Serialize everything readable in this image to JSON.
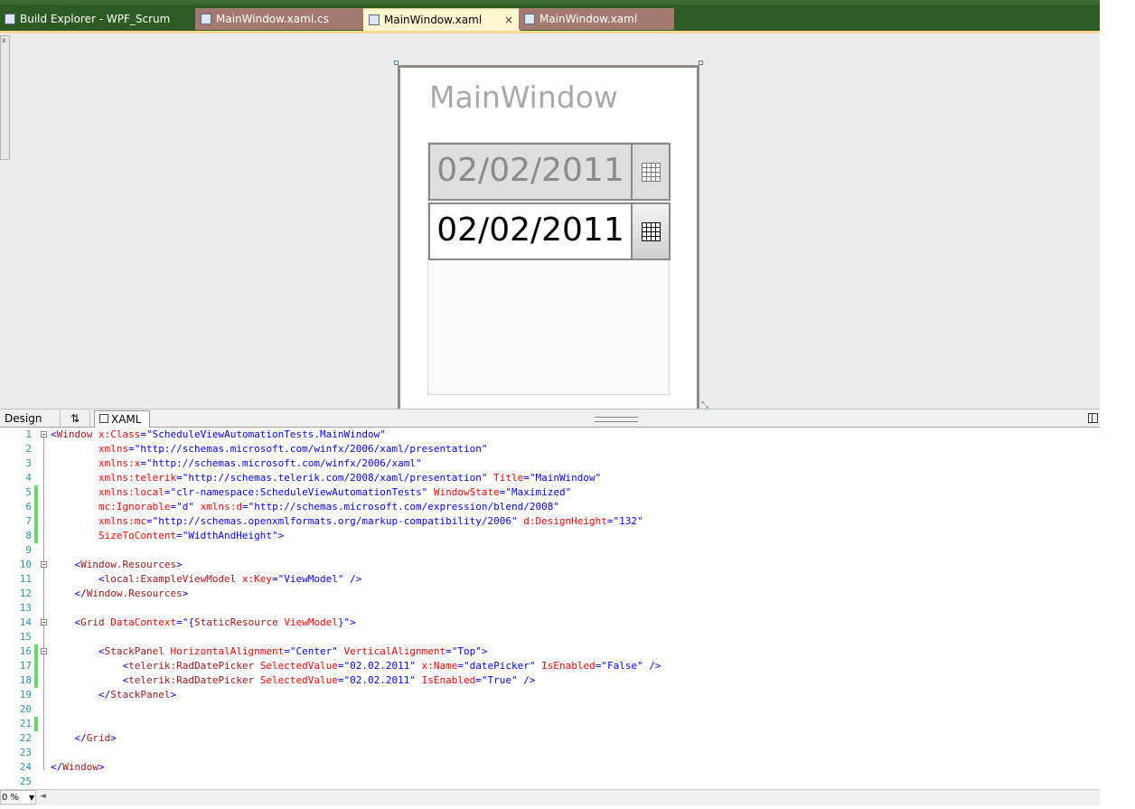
{
  "tabs": [
    {
      "label": "Build Explorer - WPF_Scrum"
    },
    {
      "label": "MainWindow.xaml.cs"
    },
    {
      "label": "MainWindow.xaml",
      "close": "×"
    },
    {
      "label": "MainWindow.xaml"
    }
  ],
  "design_preview": {
    "window_title": "MainWindow",
    "datepicker_disabled_value": "02/02/2011",
    "datepicker_enabled_value": "02/02/2011"
  },
  "pane_tabs": {
    "design": "Design",
    "swap": "⇅",
    "xaml": "XAML"
  },
  "status": {
    "zoom": "0 %"
  },
  "code_lines": [
    {
      "n": "1",
      "html": "<span class='b'>&lt;</span><span class='r'>Window</span> <span class='a'>x:Class</span><span class='b'>=\"ScheduleViewAutomationTests.MainWindow\"</span>"
    },
    {
      "n": "2",
      "html": "        <span class='a'>xmlns</span><span class='b'>=\"http://schemas.microsoft.com/winfx/2006/xaml/presentation\"</span>"
    },
    {
      "n": "3",
      "html": "        <span class='a'>xmlns:x</span><span class='b'>=\"http://schemas.microsoft.com/winfx/2006/xaml\"</span>"
    },
    {
      "n": "4",
      "html": "        <span class='a'>xmlns:telerik</span><span class='b'>=\"http://schemas.telerik.com/2008/xaml/presentation\"</span> <span class='a'>Title</span><span class='b'>=\"MainWindow\"</span>"
    },
    {
      "n": "5",
      "html": "        <span class='a'>xmlns:local</span><span class='b'>=\"clr-namespace:ScheduleViewAutomationTests\"</span> <span class='a'>WindowState</span><span class='b'>=\"Maximized\"</span>"
    },
    {
      "n": "6",
      "html": "        <span class='a'>mc:Ignorable</span><span class='b'>=\"d\"</span> <span class='a'>xmlns:d</span><span class='b'>=\"http://schemas.microsoft.com/expression/blend/2008\"</span>"
    },
    {
      "n": "7",
      "html": "        <span class='a'>xmlns:mc</span><span class='b'>=\"http://schemas.openxmlformats.org/markup-compatibility/2006\"</span> <span class='a'>d:DesignHeight</span><span class='b'>=\"132\"</span>"
    },
    {
      "n": "8",
      "html": "        <span class='a'>SizeToContent</span><span class='b'>=\"WidthAndHeight\"&gt;</span>"
    },
    {
      "n": "9",
      "html": ""
    },
    {
      "n": "10",
      "html": "    <span class='b'>&lt;</span><span class='r'>Window.Resources</span><span class='b'>&gt;</span>"
    },
    {
      "n": "11",
      "html": "        <span class='b'>&lt;</span><span class='r'>local:ExampleViewModel</span> <span class='a'>x:Key</span><span class='b'>=\"ViewModel\"</span> <span class='b'>/&gt;</span>"
    },
    {
      "n": "12",
      "html": "    <span class='b'>&lt;/</span><span class='r'>Window.Resources</span><span class='b'>&gt;</span>"
    },
    {
      "n": "13",
      "html": ""
    },
    {
      "n": "14",
      "html": "    <span class='b'>&lt;</span><span class='r'>Grid</span> <span class='a'>DataContext</span><span class='b'>=\"{</span><span class='r'>StaticResource</span> <span class='a'>ViewModel</span><span class='b'>}\"&gt;</span>"
    },
    {
      "n": "15",
      "html": ""
    },
    {
      "n": "16",
      "html": "        <span class='b'>&lt;</span><span class='r'>StackPanel</span> <span class='a'>HorizontalAlignment</span><span class='b'>=\"Center\"</span> <span class='a'>VerticalAlignment</span><span class='b'>=\"Top\"&gt;</span>"
    },
    {
      "n": "17",
      "html": "            <span class='b'>&lt;</span><span class='r'>telerik:RadDatePicker</span> <span class='a'>SelectedValue</span><span class='b'>=\"02.02.2011\"</span> <span class='a'>x:Name</span><span class='b'>=\"datePicker\"</span> <span class='a'>IsEnabled</span><span class='b'>=\"False\"</span> <span class='b'>/&gt;</span>"
    },
    {
      "n": "18",
      "html": "            <span class='b'>&lt;</span><span class='r'>telerik:RadDatePicker</span> <span class='a'>SelectedValue</span><span class='b'>=\"02.02.2011\"</span> <span class='a'>IsEnabled</span><span class='b'>=\"True\"</span> <span class='b'>/&gt;</span>"
    },
    {
      "n": "19",
      "html": "        <span class='b'>&lt;/</span><span class='r'>StackPanel</span><span class='b'>&gt;</span>"
    },
    {
      "n": "20",
      "html": ""
    },
    {
      "n": "21",
      "html": ""
    },
    {
      "n": "22",
      "html": "    <span class='b'>&lt;/</span><span class='r'>Grid</span><span class='b'>&gt;</span>"
    },
    {
      "n": "23",
      "html": ""
    },
    {
      "n": "24",
      "html": "<span class='b'>&lt;/</span><span class='r'>Window</span><span class='b'>&gt;</span>"
    },
    {
      "n": "25",
      "html": ""
    }
  ],
  "changed_lines": [
    5,
    6,
    7,
    8,
    16,
    17,
    18,
    21
  ],
  "fold_lines": [
    1,
    10,
    14,
    16
  ]
}
